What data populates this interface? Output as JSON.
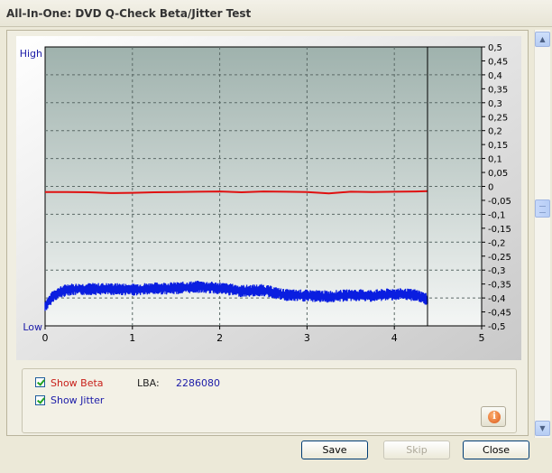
{
  "window": {
    "title": "All-In-One: DVD Q-Check Beta/Jitter Test"
  },
  "chart_data": {
    "type": "line",
    "x_ticks": [
      "0",
      "1",
      "2",
      "3",
      "4",
      "5"
    ],
    "xlim": [
      0,
      5
    ],
    "y_left_labels": {
      "top": "High",
      "bottom": "Low"
    },
    "y_right_ticks": [
      "0,5",
      "0,45",
      "0,4",
      "0,35",
      "0,3",
      "0,25",
      "0,2",
      "0,15",
      "0,1",
      "0,05",
      "0",
      "-0,05",
      "-0,1",
      "-0,15",
      "-0,2",
      "-0,25",
      "-0,3",
      "-0,35",
      "-0,4",
      "-0,45",
      "-0,5"
    ],
    "ylim": [
      -0.5,
      0.5
    ],
    "cursor_x": 4.38,
    "grid": true,
    "series": [
      {
        "color": "#e01010",
        "x": [
          0.0,
          0.25,
          0.5,
          0.75,
          1.0,
          1.25,
          1.5,
          1.75,
          2.0,
          2.25,
          2.5,
          2.75,
          3.0,
          3.25,
          3.5,
          3.75,
          4.0,
          4.25,
          4.38
        ],
        "y": [
          -0.02,
          -0.02,
          -0.021,
          -0.024,
          -0.023,
          -0.021,
          -0.02,
          -0.019,
          -0.018,
          -0.021,
          -0.018,
          -0.019,
          -0.02,
          -0.025,
          -0.019,
          -0.02,
          -0.019,
          -0.018,
          -0.017
        ]
      },
      {
        "color": "#0a1ee0",
        "band": true,
        "x": [
          0.0,
          0.1,
          0.25,
          0.5,
          0.75,
          1.0,
          1.25,
          1.5,
          1.75,
          2.0,
          2.25,
          2.5,
          2.75,
          3.0,
          3.25,
          3.5,
          3.75,
          4.0,
          4.25,
          4.38
        ],
        "y": [
          -0.43,
          -0.39,
          -0.37,
          -0.368,
          -0.368,
          -0.37,
          -0.366,
          -0.365,
          -0.36,
          -0.365,
          -0.375,
          -0.372,
          -0.39,
          -0.392,
          -0.395,
          -0.39,
          -0.392,
          -0.386,
          -0.39,
          -0.405
        ],
        "spread": 0.022
      }
    ]
  },
  "controls": {
    "show_beta": {
      "label": "Show Beta",
      "checked": true
    },
    "show_jitter": {
      "label": "Show Jitter",
      "checked": true
    },
    "lba_label": "LBA:",
    "lba_value": "2286080"
  },
  "buttons": {
    "save": "Save",
    "skip": "Skip",
    "close": "Close"
  },
  "icons": {
    "info": "info-icon",
    "scroll_up": "chevron-up-icon",
    "scroll_down": "chevron-down-icon"
  }
}
